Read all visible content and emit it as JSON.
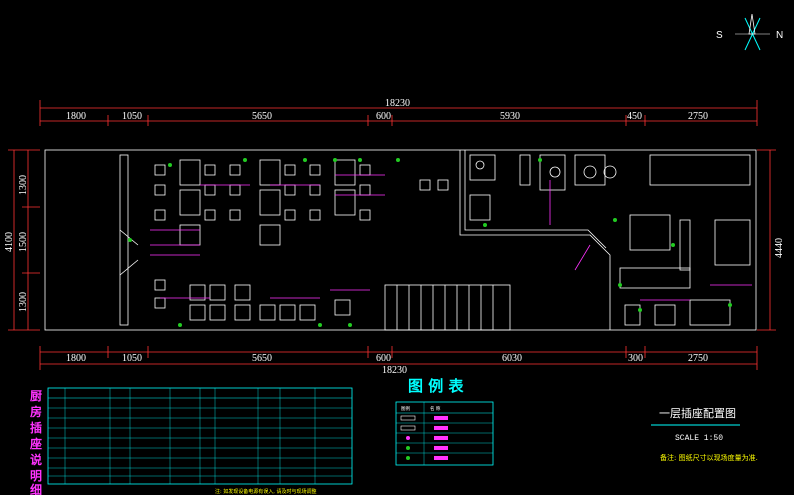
{
  "compass": {
    "south": "S",
    "north": "N"
  },
  "dims_top": {
    "total": "18230",
    "segments": [
      "1800",
      "1050",
      "5650",
      "600",
      "5930",
      "450",
      "2750"
    ]
  },
  "dims_bottom": {
    "total": "18230",
    "segments": [
      "1800",
      "1050",
      "5650",
      "600",
      "6030",
      "300",
      "2750"
    ]
  },
  "dims_left": {
    "total": "4100",
    "segments": [
      "1300",
      "1500",
      "1300"
    ]
  },
  "dims_right": {
    "total": "4440"
  },
  "side_title": [
    "厨",
    "房",
    "插",
    "座",
    "说",
    "明",
    "细"
  ],
  "legend": {
    "title": "图 例 表",
    "col1": "图例",
    "col2": "名 称"
  },
  "drawing_title": "一层插座配置图",
  "scale": "SCALE 1:50",
  "note": "备注: 图纸尺寸以现场度量为准.",
  "footnote": "注: 如发现设备电源有误入, 请及时与现场调整"
}
